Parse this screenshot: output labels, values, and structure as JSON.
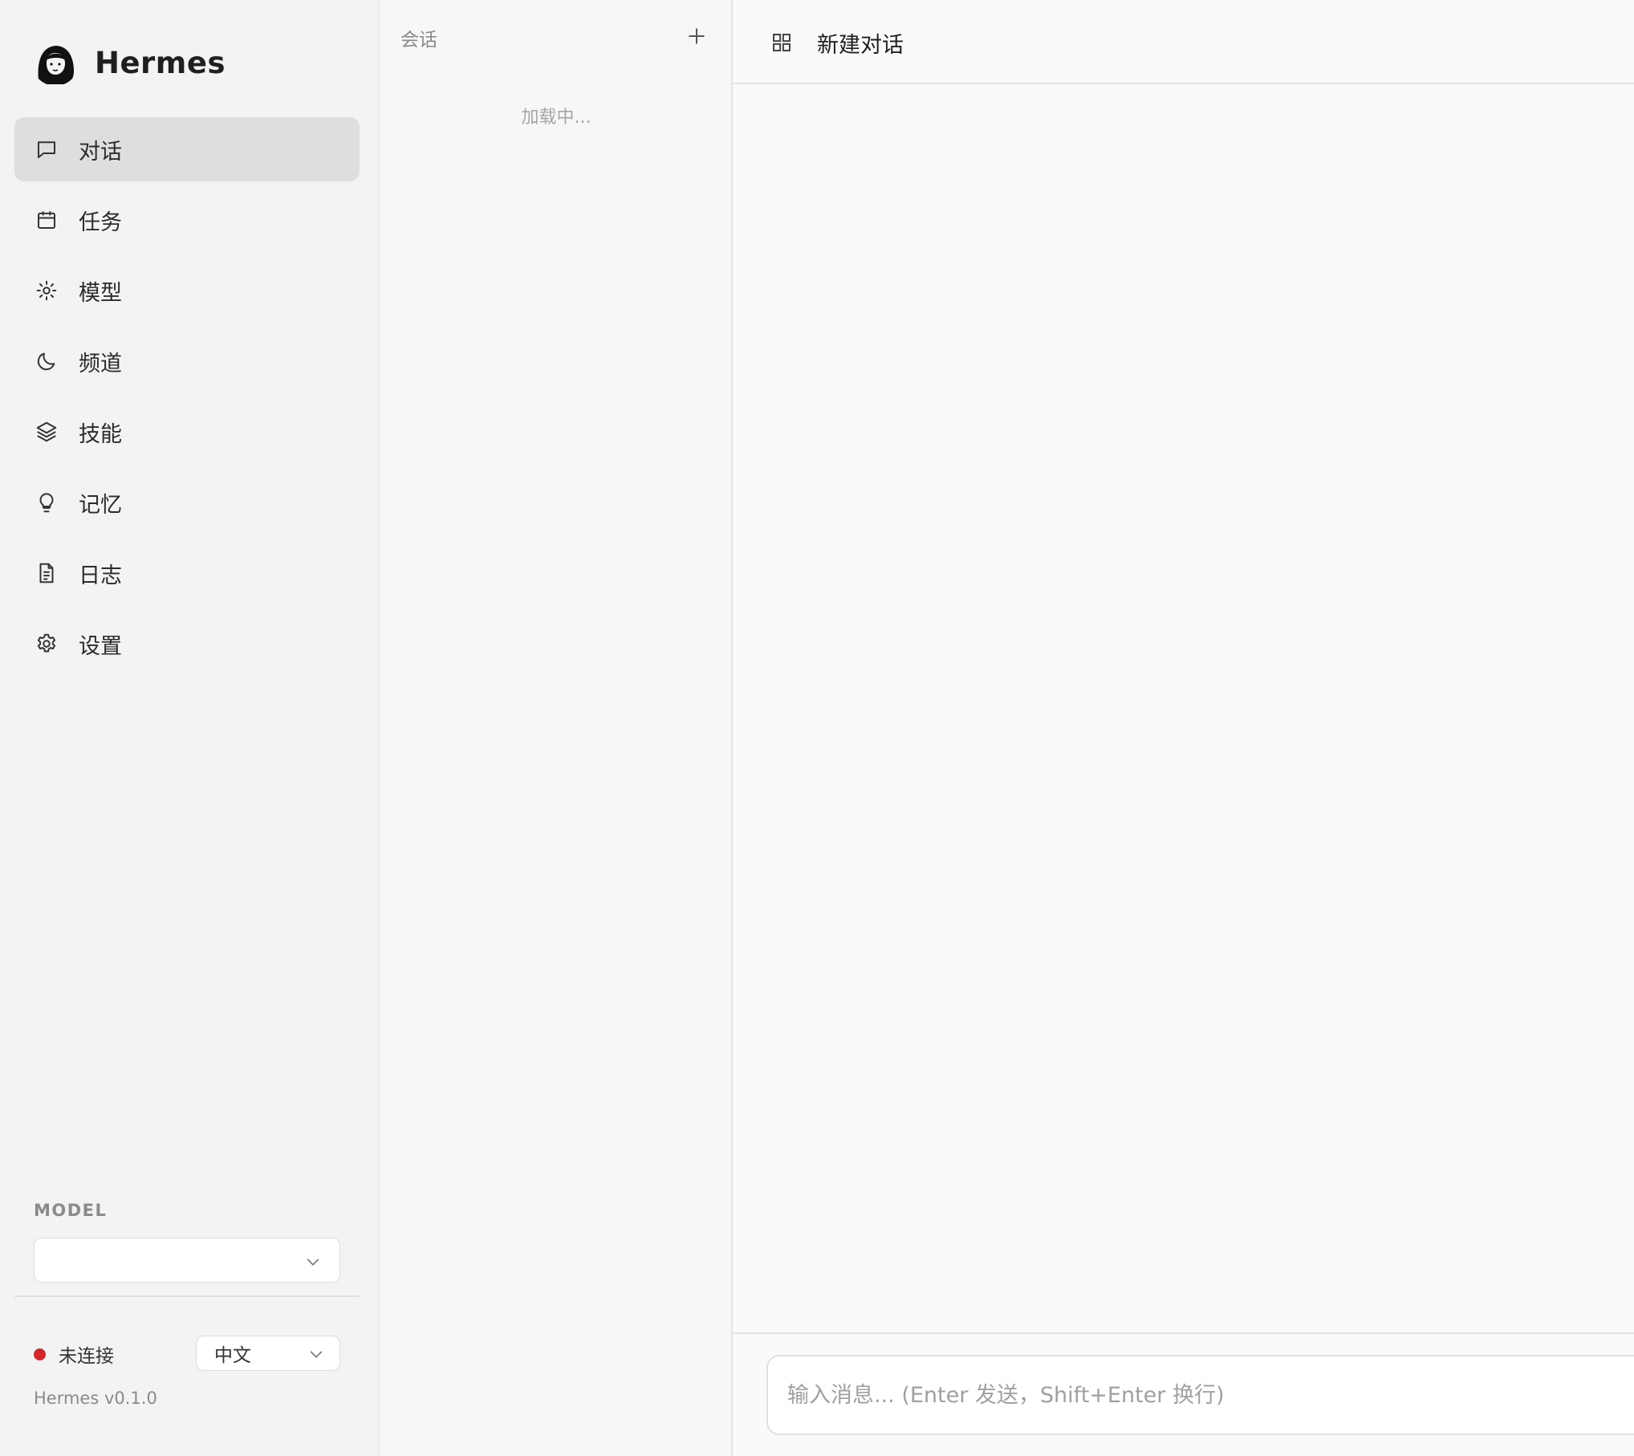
{
  "brand": {
    "name": "Hermes",
    "avatar_icon": "portrait-avatar"
  },
  "nav": {
    "items": [
      {
        "label": "对话",
        "icon": "chat-bubble-icon",
        "active": true
      },
      {
        "label": "任务",
        "icon": "calendar-icon",
        "active": false
      },
      {
        "label": "模型",
        "icon": "sun-icon",
        "active": false
      },
      {
        "label": "频道",
        "icon": "moon-icon",
        "active": false
      },
      {
        "label": "技能",
        "icon": "layers-icon",
        "active": false
      },
      {
        "label": "记忆",
        "icon": "lightbulb-icon",
        "active": false
      },
      {
        "label": "日志",
        "icon": "document-icon",
        "active": false
      },
      {
        "label": "设置",
        "icon": "gear-icon",
        "active": false
      }
    ]
  },
  "model": {
    "title": "MODEL",
    "selected": ""
  },
  "status": {
    "text": "未连接",
    "color": "#d3262b"
  },
  "language": {
    "selected": "中文"
  },
  "version": "Hermes v0.1.0",
  "sessions": {
    "title": "会话",
    "loading_text": "加载中..."
  },
  "chat": {
    "title": "新建对话",
    "input_placeholder": "输入消息... (Enter 发送，Shift+Enter 换行)",
    "input_value": ""
  }
}
